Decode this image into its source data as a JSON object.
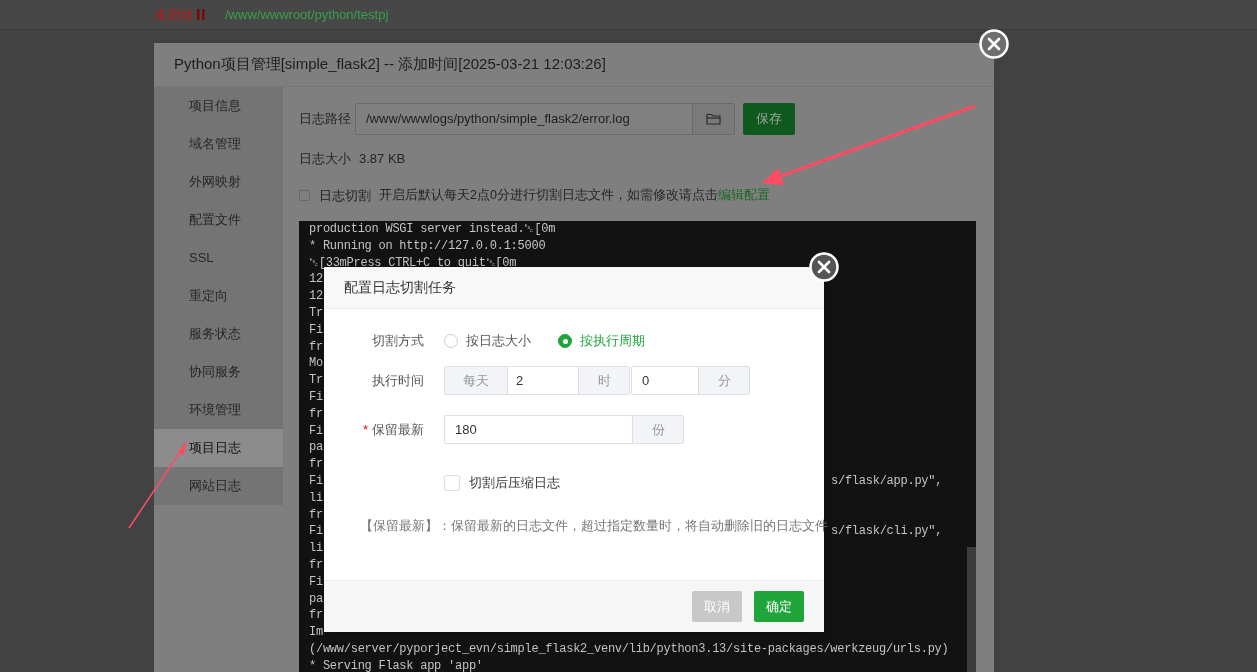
{
  "top_bar": {
    "status": "未启动",
    "path": "/www/wwwroot/python/testpj"
  },
  "dialog": {
    "title": "Python项目管理[simple_flask2] -- 添加时间[2025-03-21 12:03:26]",
    "sidebar": [
      {
        "label": "项目信息",
        "selected": false
      },
      {
        "label": "域名管理",
        "selected": false
      },
      {
        "label": "外网映射",
        "selected": false
      },
      {
        "label": "配置文件",
        "selected": false
      },
      {
        "label": "SSL",
        "selected": false
      },
      {
        "label": "重定向",
        "selected": false
      },
      {
        "label": "服务状态",
        "selected": false
      },
      {
        "label": "协同服务",
        "selected": false
      },
      {
        "label": "环境管理",
        "selected": false
      },
      {
        "label": "项目日志",
        "selected": true
      },
      {
        "label": "网站日志",
        "selected": false
      }
    ],
    "log_path": {
      "label": "日志路径",
      "value": "/www/wwwlogs/python/simple_flask2/error.log",
      "save": "保存"
    },
    "log_size": {
      "label": "日志大小",
      "value": "3.87 KB"
    },
    "log_split": {
      "checked": false,
      "label": "日志切割",
      "description": "开启后默认每天2点0分进行切割日志文件，如需修改请点击",
      "link": "编辑配置"
    },
    "log_lines": [
      {
        "text": "production WSGI server instead.␛[0m"
      },
      {
        "text": "* Running on http://127.0.0.1:5000"
      },
      {
        "text": "␛[33mPress CTRL+C to quit␛[0m"
      },
      {
        "text": "12"
      },
      {
        "text": "12"
      },
      {
        "text": "Tr"
      },
      {
        "text": "Fi"
      },
      {
        "text": "fr"
      },
      {
        "text": "Mo"
      },
      {
        "text": "Tr"
      },
      {
        "text": "Fi"
      },
      {
        "text": "fr"
      },
      {
        "text": "Fi"
      },
      {
        "text": "pa"
      },
      {
        "text": "fr"
      },
      {
        "text": "Fi",
        "tail": "s/flask/app.py\","
      },
      {
        "text": "li"
      },
      {
        "text": "fr"
      },
      {
        "text": "Fi",
        "tail": "s/flask/cli.py\","
      },
      {
        "text": "li"
      },
      {
        "text": "fr"
      },
      {
        "text": "Fi"
      },
      {
        "text": "pa"
      },
      {
        "text": "fr"
      },
      {
        "text": "Im"
      },
      {
        "text": "(/www/server/pyporject_evn/simple_flask2_venv/lib/python3.13/site-packages/werkzeug/urls.py)"
      },
      {
        "text": "* Serving Flask app 'app'"
      }
    ]
  },
  "modal": {
    "title": "配置日志切割任务",
    "mode": {
      "label": "切割方式",
      "options": [
        {
          "label": "按日志大小",
          "selected": false
        },
        {
          "label": "按执行周期",
          "selected": true
        }
      ]
    },
    "time": {
      "label": "执行时间",
      "period": "每天",
      "hour": "2",
      "hour_unit": "时",
      "minute": "0",
      "minute_unit": "分"
    },
    "keep": {
      "label": "保留最新",
      "required": true,
      "required_mark": "*",
      "value": "180",
      "unit": "份"
    },
    "compress": {
      "label": "切割后压缩日志",
      "checked": false
    },
    "note": "【保留最新】：保留最新的日志文件，超过指定数量时，将自动删除旧的日志文件",
    "cancel": "取消",
    "confirm": "确定"
  }
}
